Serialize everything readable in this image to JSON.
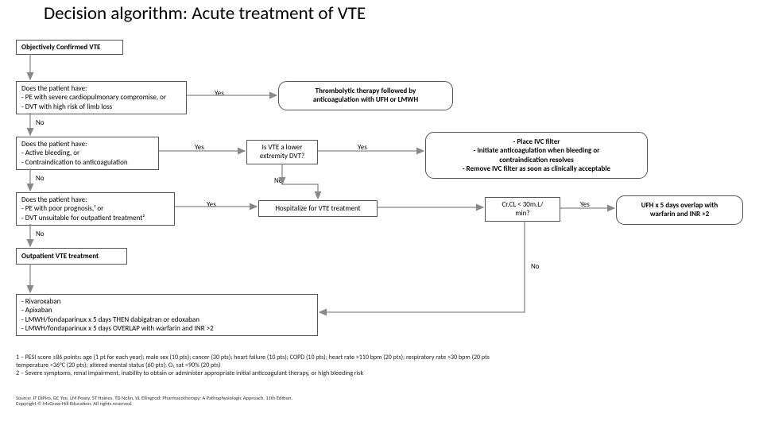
{
  "title": "Decision algorithm: Acute treatment of VTE",
  "nodes": {
    "start": "Objectively Confirmed VTE",
    "q1": "Does the patient have:\n- PE with severe cardiopulmonary compromise, or\n- DVT with high risk of limb loss",
    "q2": "Does the patient have:\n- Active bleeding, or\n- Contraindication to anticoagulation",
    "q3": "Does the patient have:\n- PE with poor prognosis,¹ or\n- DVT unsuitable for outpatient treatment²",
    "outpt": "Outpatient VTE treatment",
    "tx_thromb": "Thrombolytic therapy followed by\nanticoagulation with UFH or LMWH",
    "q_lower": "Is VTE a lower\nextremity DVT?",
    "tx_ivc": "- Place IVC filter\n- Initiate anticoagulation when bleeding or\ncontraindication resolves\n- Remove IVC filter as soon as clinically acceptable",
    "tx_hosp": "Hospitalize for VTE treatment",
    "q_crcl": "Cr.CL < 30m.L/\nmin?",
    "tx_ufh": "UFH x 5 days overlap with\nwarfarin and INR >2",
    "tx_regimens": "- Rivaroxaban\n- Apixaban\n- LMWH/fondaparinux x 5 days THEN dabigatran or edoxaban\n- LMWH/fondaparinux x 5 days OVERLAP with warfarin and INR >2"
  },
  "labels": {
    "yes": "Yes",
    "no": "No"
  },
  "footnotes": "1 – PESI score ≥86 points:  age (1 pt for each year); male sex (10 pts); cancer (30 pts); heart failure (10 pts); COPD (10 pts); heart rate >110 bpm (20 pts); respiratory rate >30 bpm (20 pts\ntemperature <36°C (20 pts); altered mental status (60 pts); O₂ sat <90% (20 pts)\n2 – Severe symptoms, renal impairment, inability to obtain or administer appropriate initial anticoagulant therapy, or high bleeding risk",
  "source": "Source: JT DiPiro, GC Yee, LM Posey, ST Haines, TD Nolin, VL Ellingrod:  Pharmacotherapy: A Pathophysiologic Approach, 11th Edition.\nCopyright © McGraw-Hill Education. All rights reserved."
}
